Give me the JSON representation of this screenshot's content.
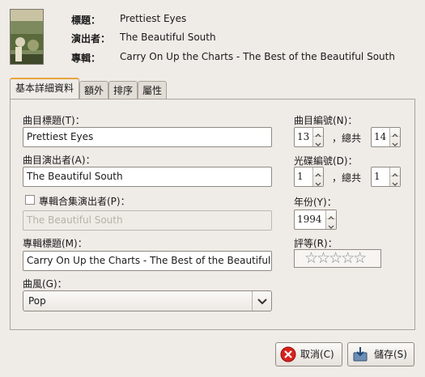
{
  "header": {
    "title_label": "標題：",
    "title_value": "Prettiest Eyes",
    "artist_label": "演出者：",
    "artist_value": "The Beautiful South",
    "album_label": "專輯：",
    "album_value": "Carry On Up the Charts - The Best of the Beautiful South",
    "cover_text": "CARRY ON UP THE CHARTS"
  },
  "tabs": [
    "基本詳細資料",
    "額外",
    "排序",
    "屬性"
  ],
  "form": {
    "track_title_label": "曲目標題(T)：",
    "track_title_value": "Prettiest Eyes",
    "track_artist_label": "曲目演出者(A)：",
    "track_artist_value": "The Beautiful South",
    "compilation_label": "專輯合集演出者(P)：",
    "compilation_value": "The Beautiful South",
    "album_title_label": "專輯標題(M)：",
    "album_title_value": "Carry On Up the Charts - The Best of the Beautiful South",
    "genre_label": "曲風(G)：",
    "genre_value": "Pop",
    "track_number_label": "曲目編號(N)：",
    "track_number_value": "13",
    "track_total_label": "，總共",
    "track_total_value": "14",
    "disc_number_label": "光碟編號(D)：",
    "disc_number_value": "1",
    "disc_total_label": "，總共",
    "disc_total_value": "1",
    "year_label": "年份(Y)：",
    "year_value": "1994",
    "rating_label": "評等(R)：",
    "rating_stars": "☆☆☆☆☆",
    "rating_value": 0,
    "compilation_checked": false
  },
  "buttons": {
    "cancel": "取消(C)",
    "save": "儲存(S)"
  }
}
